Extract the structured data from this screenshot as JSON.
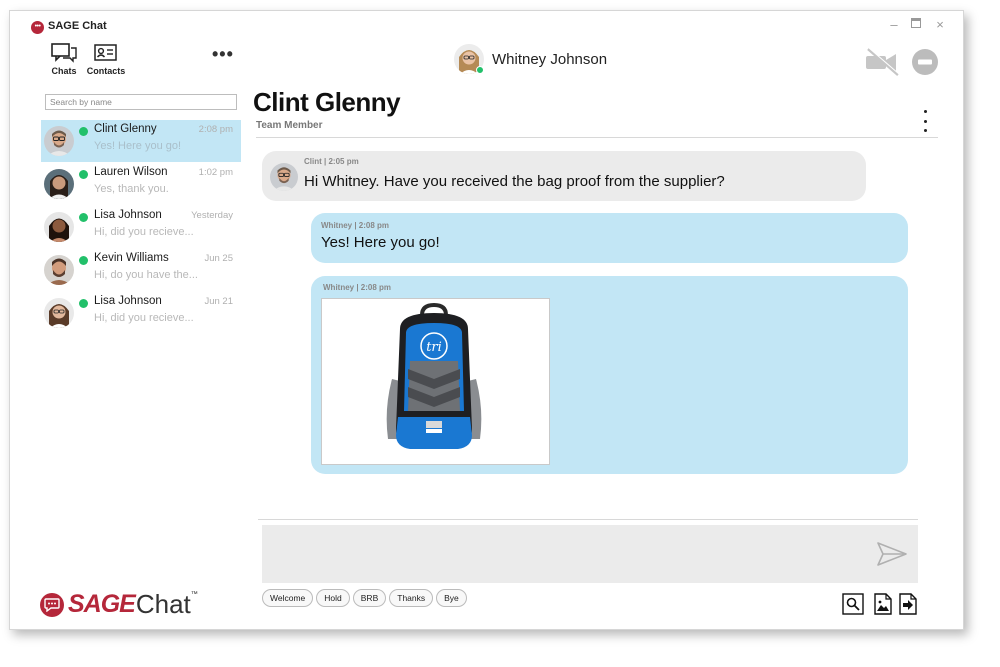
{
  "app": {
    "title": "SAGE Chat",
    "window_controls": {
      "minimize": "–",
      "maximize": "▢",
      "close": "×"
    }
  },
  "nav": {
    "chats_label": "Chats",
    "contacts_label": "Contacts",
    "more": "•••"
  },
  "search": {
    "placeholder": "Search by name"
  },
  "conversations": [
    {
      "name": "Clint Glenny",
      "time": "2:08 pm",
      "preview": "Yes! Here you go!",
      "online": true,
      "active": true
    },
    {
      "name": "Lauren Wilson",
      "time": "1:02 pm",
      "preview": "Yes, thank you.",
      "online": true,
      "active": false
    },
    {
      "name": "Lisa Johnson",
      "time": "Yesterday",
      "preview": "Hi, did you recieve...",
      "online": true,
      "active": false
    },
    {
      "name": "Kevin Williams",
      "time": "Jun 25",
      "preview": "Hi, do you have the...",
      "online": true,
      "active": false
    },
    {
      "name": "Lisa Johnson",
      "time": "Jun 21",
      "preview": "Hi, did you recieve...",
      "online": true,
      "active": false
    }
  ],
  "header": {
    "user_name": "Whitney Johnson",
    "user_online": true,
    "video_icon": "video-off-icon",
    "status_icon": "do-not-disturb-icon"
  },
  "chat": {
    "contact_name": "Clint Glenny",
    "contact_role": "Team Member",
    "messages": [
      {
        "sender": "Clint",
        "time": "2:05 pm",
        "meta": "Clint | 2:05 pm",
        "text": "Hi Whitney. Have you received the bag proof from the supplier?",
        "direction": "in"
      },
      {
        "sender": "Whitney",
        "time": "2:08 pm",
        "meta": "Whitney | 2:08 pm",
        "text": "Yes! Here you go!",
        "direction": "out"
      },
      {
        "sender": "Whitney",
        "time": "2:08 pm",
        "meta": "Whitney | 2:08 pm",
        "attachment": "backpack-image",
        "logo_text": "tri",
        "direction": "out"
      }
    ]
  },
  "compose": {
    "placeholder": "",
    "send_icon": "send-icon"
  },
  "quick_replies": [
    "Welcome",
    "Hold",
    "BRB",
    "Thanks",
    "Bye"
  ],
  "tools": [
    "search-icon",
    "image-file-icon",
    "send-file-icon"
  ],
  "brand": {
    "sage": "SAGE",
    "chat": "Chat",
    "tm": "™"
  },
  "colors": {
    "brand_red": "#b5273a",
    "bubble_blue": "#c2e6f5",
    "bubble_grey": "#ebebeb",
    "online_green": "#22c06a"
  }
}
